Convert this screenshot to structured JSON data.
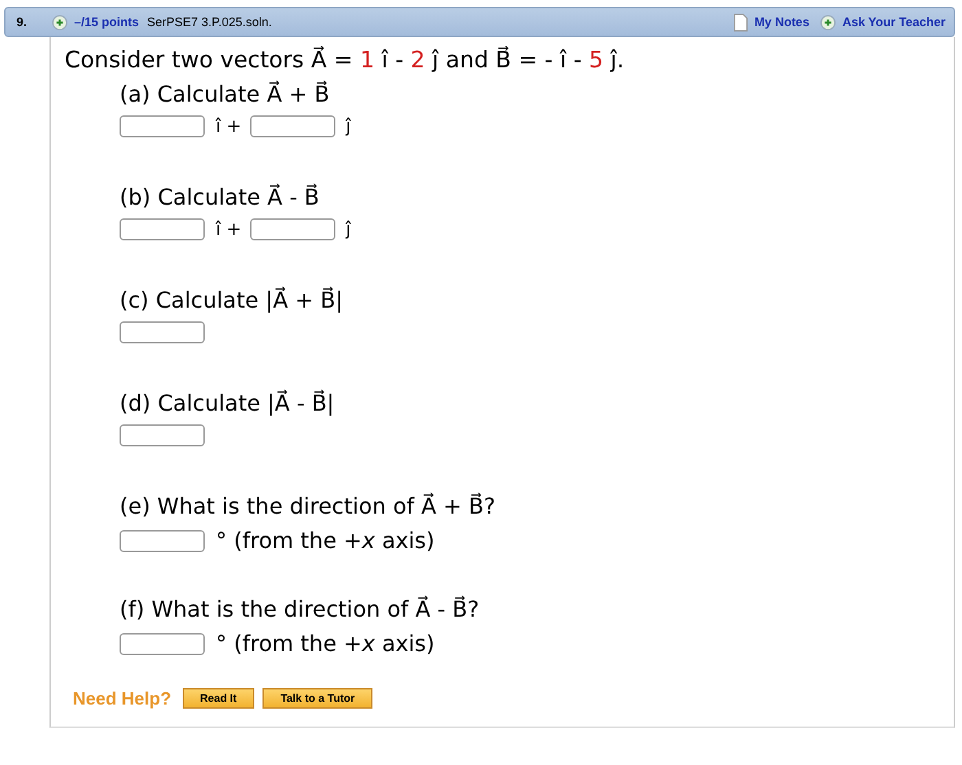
{
  "header": {
    "number": "9.",
    "points": "–/15 points",
    "source": "SerPSE7 3.P.025.soln.",
    "links": [
      "My Notes",
      "Ask Your Teacher"
    ]
  },
  "statement": [
    {
      "kind": "plain",
      "text": "Consider two vectors A⃗ ="
    },
    {
      "kind": "number",
      "text": "1"
    },
    {
      "kind": "plain",
      "text": "î -"
    },
    {
      "kind": "number",
      "text": "2"
    },
    {
      "kind": "plain",
      "text": "ĵ and B⃗ = - î -"
    },
    {
      "kind": "number",
      "text": "5"
    },
    {
      "kind": "plain",
      "text": "ĵ."
    }
  ],
  "parts": [
    {
      "question": "(a) Calculate A⃗ + B⃗",
      "answer": [
        {
          "kind": "field"
        },
        {
          "kind": "unit",
          "text": "î +"
        },
        {
          "kind": "field"
        },
        {
          "kind": "unit",
          "text": "ĵ"
        }
      ]
    },
    {
      "question": "(b) Calculate A⃗ - B⃗",
      "answer": [
        {
          "kind": "field"
        },
        {
          "kind": "unit",
          "text": "î +"
        },
        {
          "kind": "field"
        },
        {
          "kind": "unit",
          "text": "ĵ"
        }
      ]
    },
    {
      "question": "(c) Calculate |A⃗ + B⃗|",
      "answer": [
        {
          "kind": "field"
        }
      ]
    },
    {
      "question": "(d) Calculate |A⃗ - B⃗|",
      "answer": [
        {
          "kind": "field"
        }
      ]
    },
    {
      "question": "(e) What is the direction of A⃗ + B⃗?",
      "answer": [
        {
          "kind": "field"
        },
        {
          "kind": "unit",
          "text": "° (from the +*x* axis)"
        }
      ]
    },
    {
      "question": "(f) What is the direction of A⃗ - B⃗?",
      "answer": [
        {
          "kind": "field"
        },
        {
          "kind": "unit",
          "text": "° (from the +*x* axis)"
        }
      ]
    }
  ],
  "help": {
    "label": "Need Help?",
    "buttons": [
      "Read It",
      "Talk to a Tutor"
    ]
  }
}
